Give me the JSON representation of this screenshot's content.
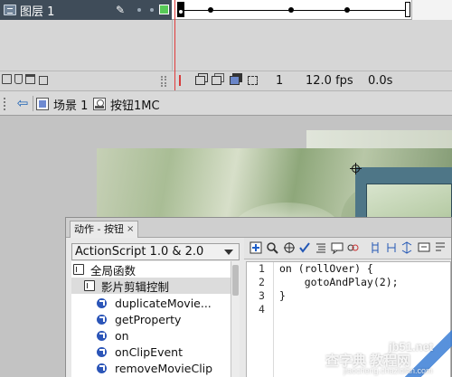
{
  "timeline": {
    "layer_name": "图层 1",
    "current_frame": "1",
    "fps": "12.0 fps",
    "elapsed_time": "0.0s"
  },
  "editbar": {
    "crumbs": [
      {
        "label": "场景 1",
        "icon": "scene-icon"
      },
      {
        "label": "按钮1MC",
        "icon": "movieclip-symbol-icon"
      }
    ]
  },
  "actions_panel": {
    "tab_title": "动作 - 按钮",
    "close_glyph": "×",
    "language_select": "ActionScript 1.0 & 2.0",
    "tree": [
      {
        "label": "全局函数",
        "type": "book",
        "level": 0
      },
      {
        "label": "影片剪辑控制",
        "type": "book",
        "level": 1
      },
      {
        "label": "duplicateMovie...",
        "type": "action",
        "level": 2
      },
      {
        "label": "getProperty",
        "type": "action",
        "level": 2
      },
      {
        "label": "on",
        "type": "action",
        "level": 2
      },
      {
        "label": "onClipEvent",
        "type": "action",
        "level": 2
      },
      {
        "label": "removeMovieClip",
        "type": "action",
        "level": 2
      }
    ],
    "line_numbers": [
      "1",
      "2",
      "3",
      "4"
    ],
    "code_lines": [
      "on (rollOver) {",
      "    gotoAndPlay(2);",
      "}",
      ""
    ]
  },
  "watermark": {
    "site": "jb51.net",
    "brand": "查字典 教程网",
    "url": "jiaocheng.chazidian.com"
  }
}
